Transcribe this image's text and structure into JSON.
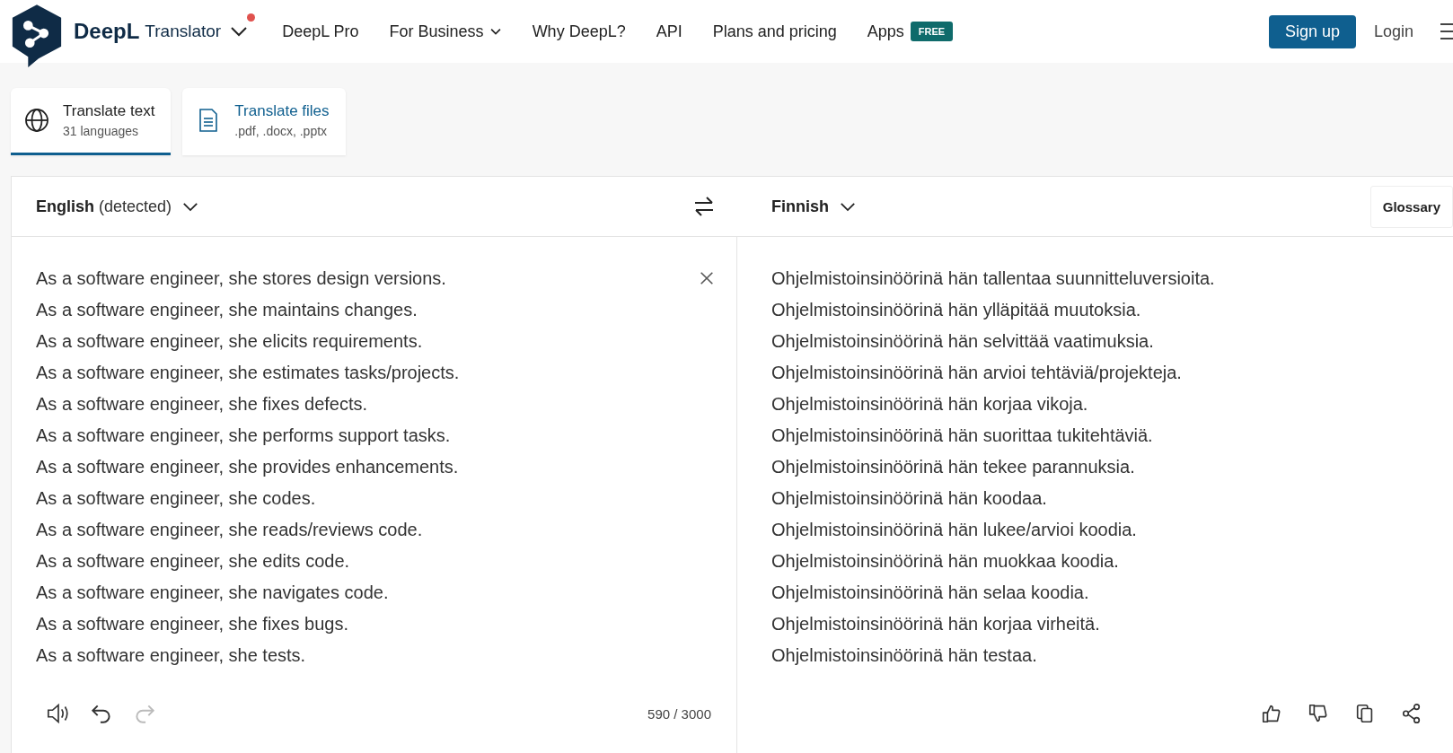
{
  "header": {
    "brand": "DeepL",
    "product": "Translator",
    "notification": true,
    "nav": [
      {
        "label": "DeepL Pro",
        "dropdown": false
      },
      {
        "label": "For Business",
        "dropdown": true
      },
      {
        "label": "Why DeepL?",
        "dropdown": false
      },
      {
        "label": "API",
        "dropdown": false
      },
      {
        "label": "Plans and pricing",
        "dropdown": false
      },
      {
        "label": "Apps",
        "dropdown": false,
        "badge": "FREE"
      }
    ],
    "signup": "Sign up",
    "login": "Login"
  },
  "tabs": [
    {
      "kind": "text",
      "title": "Translate text",
      "subtitle": "31 languages",
      "selected": true
    },
    {
      "kind": "files",
      "title": "Translate files",
      "subtitle": ".pdf, .docx, .pptx",
      "selected": false
    }
  ],
  "source": {
    "language": "English",
    "note": "(detected)",
    "lines": [
      "As a software engineer, she stores design versions.",
      "As a software engineer, she maintains changes.",
      "As a software engineer, she elicits requirements.",
      "As a software engineer, she estimates tasks/projects.",
      "As a software engineer, she fixes defects.",
      "As a software engineer, she performs support tasks.",
      "As a software engineer, she provides enhancements.",
      "As a software engineer, she codes.",
      "As a software engineer, she reads/reviews code.",
      "As a software engineer, she edits code.",
      "As a software engineer, she navigates code.",
      "As a software engineer, she fixes bugs.",
      "As a software engineer, she tests."
    ],
    "counter": "590 / 3000",
    "redo_disabled": true
  },
  "target": {
    "language": "Finnish",
    "glossary": "Glossary",
    "lines": [
      "Ohjelmistoinsinöörinä hän tallentaa suunnitteluversioita.",
      "Ohjelmistoinsinöörinä hän ylläpitää muutoksia.",
      "Ohjelmistoinsinöörinä hän selvittää vaatimuksia.",
      "Ohjelmistoinsinöörinä hän arvioi tehtäviä/projekteja.",
      "Ohjelmistoinsinöörinä hän korjaa vikoja.",
      "Ohjelmistoinsinöörinä hän suorittaa tukitehtäviä.",
      "Ohjelmistoinsinöörinä hän tekee parannuksia.",
      "Ohjelmistoinsinöörinä hän koodaa.",
      "Ohjelmistoinsinöörinä hän lukee/arvioi koodia.",
      "Ohjelmistoinsinöörinä hän muokkaa koodia.",
      "Ohjelmistoinsinöörinä hän selaa koodia.",
      "Ohjelmistoinsinöörinä hän korjaa virheitä.",
      "Ohjelmistoinsinöörinä hän testaa."
    ]
  }
}
